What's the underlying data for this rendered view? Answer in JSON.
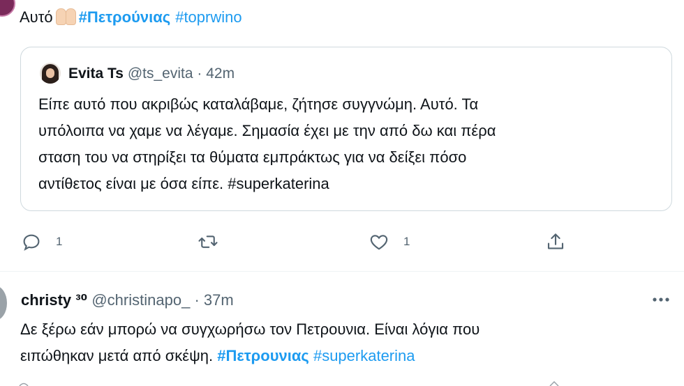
{
  "top_tweet": {
    "text": "Αυτό",
    "emoji": "raised-hands",
    "hashtag_bold": "#Πετρούνιας",
    "hashtag": "#toprwino"
  },
  "quote": {
    "name": "Evita Ts",
    "handle": "@ts_evita",
    "separator": "·",
    "time": "42m",
    "lines": [
      "Είπε αυτό που ακριβώς καταλάβαμε, ζήτησε συγγνώμη. Αυτό. Τα",
      "υπόλοιπα να χαμε να λέγαμε. Σημασία έχει με την από δω και πέρα",
      "σταση του να στηρίξει τα θύματα εμπράκτως για να δείξει πόσο",
      "αντίθετος είναι με όσα είπε. #superkaterina"
    ]
  },
  "actions": {
    "reply_count": "1",
    "retweet_count": "",
    "like_count": "1",
    "icons": [
      "reply-icon",
      "retweet-icon",
      "like-icon",
      "share-icon"
    ]
  },
  "tweet2": {
    "name": "christy ³⁰",
    "handle": "@christinapo_",
    "separator": "·",
    "time": "37m",
    "line1": "Δε ξέρω εάν μπορώ να συγχωρήσω τον Πετρουνια. Είναι λόγια που",
    "line2_text": "ειπώθηκαν μετά από σκέψη.",
    "line2_hashtag_bold": "#Πετρουνιας",
    "line2_hashtag": "#superkaterina"
  },
  "colors": {
    "accent": "#1d9bf0",
    "text": "#0f1419",
    "muted": "#536471",
    "border": "#cfd9de"
  }
}
